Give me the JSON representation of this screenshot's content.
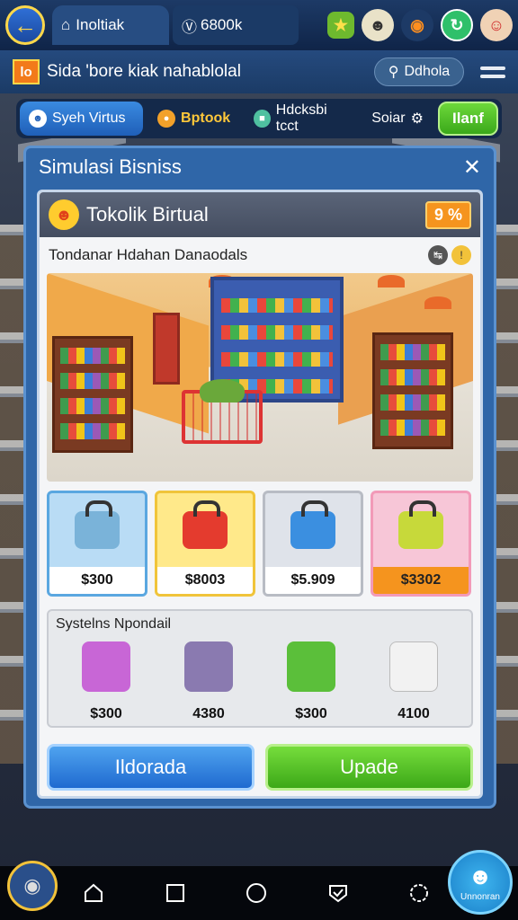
{
  "top_bar": {
    "tab_label": "Inoltiak",
    "coins": "6800k",
    "icons": [
      "back-arrow-icon",
      "home-icon",
      "level-icon",
      "player-icon",
      "gift-icon",
      "refresh-icon",
      "avatar-icon"
    ]
  },
  "header": {
    "logo": "lo",
    "title": "Sida 'bore kiak nahablolal",
    "search_label": "Ddhola"
  },
  "categories": {
    "active": "Syeh Virtus",
    "item2": "Bptook",
    "item3": "Hdcksbi tcct",
    "item4": "Soiar",
    "action": "Ilanf"
  },
  "panel": {
    "title": "Simulasi Bisniss",
    "store_name": "Tokolik Birtual",
    "level_badge": "9 %",
    "subtitle": "Tondanar Hdahan Danaodals"
  },
  "items": [
    {
      "price": "$300",
      "color": "#b9dcf5",
      "border": "#5aa7e0"
    },
    {
      "price": "$8003",
      "color": "#ffe98a",
      "border": "#f0c43a"
    },
    {
      "price": "$5.909",
      "color": "#dfe3ea",
      "border": "#b8bcc4"
    },
    {
      "price": "$3302",
      "color": "#f7c6d7",
      "border": "#f29ab8"
    }
  ],
  "systems": {
    "title": "Systelns Npondail",
    "items": [
      {
        "price": "$300",
        "color": "#c866d6"
      },
      {
        "price": "4380",
        "color": "#8a7ab0"
      },
      {
        "price": "$300",
        "color": "#5bbf3a"
      },
      {
        "price": "4100",
        "color": "#f2f2f2"
      }
    ]
  },
  "buttons": {
    "left": "Ildorada",
    "right": "Upade"
  },
  "bottom_nav": {
    "round_label": "Unnonran",
    "icons": [
      "home-icon",
      "square-icon",
      "circle-icon",
      "shield-check-icon",
      "settings-icon"
    ]
  }
}
